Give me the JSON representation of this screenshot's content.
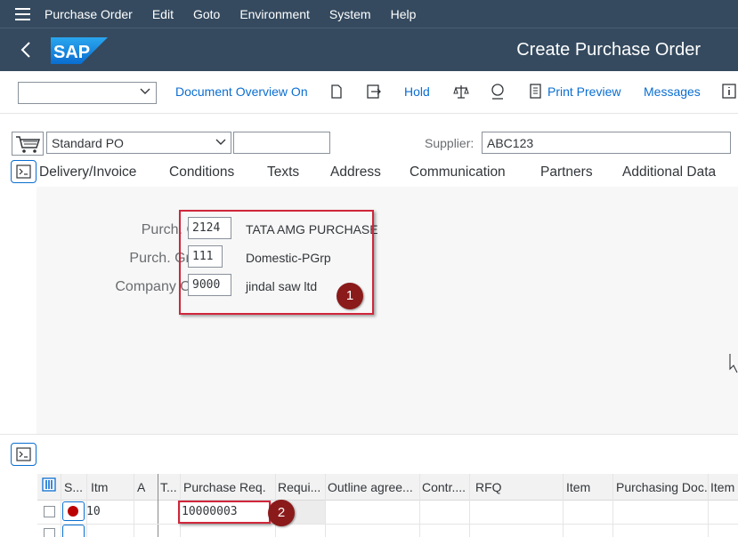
{
  "menubar": {
    "items": [
      "Purchase Order",
      "Edit",
      "Goto",
      "Environment",
      "System",
      "Help"
    ]
  },
  "shell": {
    "title": "Create Purchase Order",
    "logo_text": "SAP"
  },
  "toolbar": {
    "dropdown_value": "",
    "document_overview_label": "Document Overview On",
    "hold_label": "Hold",
    "print_preview_label": "Print Preview",
    "messages_label": "Messages"
  },
  "header": {
    "doc_type": "Standard PO",
    "doc_number": "",
    "supplier_label": "Supplier:",
    "supplier_value": "ABC123"
  },
  "tabs": [
    "Delivery/Invoice",
    "Conditions",
    "Texts",
    "Address",
    "Communication",
    "Partners",
    "Additional Data"
  ],
  "org": {
    "purch_org_label": "Purch. Org.:",
    "purch_org_value": "2124",
    "purch_org_text": "TATA AMG PURCHASE",
    "purch_group_label": "Purch. Group:",
    "purch_group_value": "111",
    "purch_group_text": "Domestic-PGrp",
    "company_code_label": "Company Code:",
    "company_code_value": "9000",
    "company_code_text": "jindal saw ltd"
  },
  "markers": {
    "one": "1",
    "two": "2"
  },
  "grid": {
    "columns": [
      "S...",
      "Itm",
      "A",
      "T...",
      "Purchase Req.",
      "Requi...",
      "Outline agree...",
      "Contr....",
      "RFQ",
      "Item",
      "Purchasing Doc.",
      "Item"
    ],
    "rows": [
      {
        "item": "10",
        "purchase_req": "10000003"
      }
    ]
  },
  "colors": {
    "shell_bg": "#354a5f",
    "link_blue": "#0a6ed1",
    "highlight_red": "#d0263b",
    "marker_bg": "#8b1a1a"
  }
}
